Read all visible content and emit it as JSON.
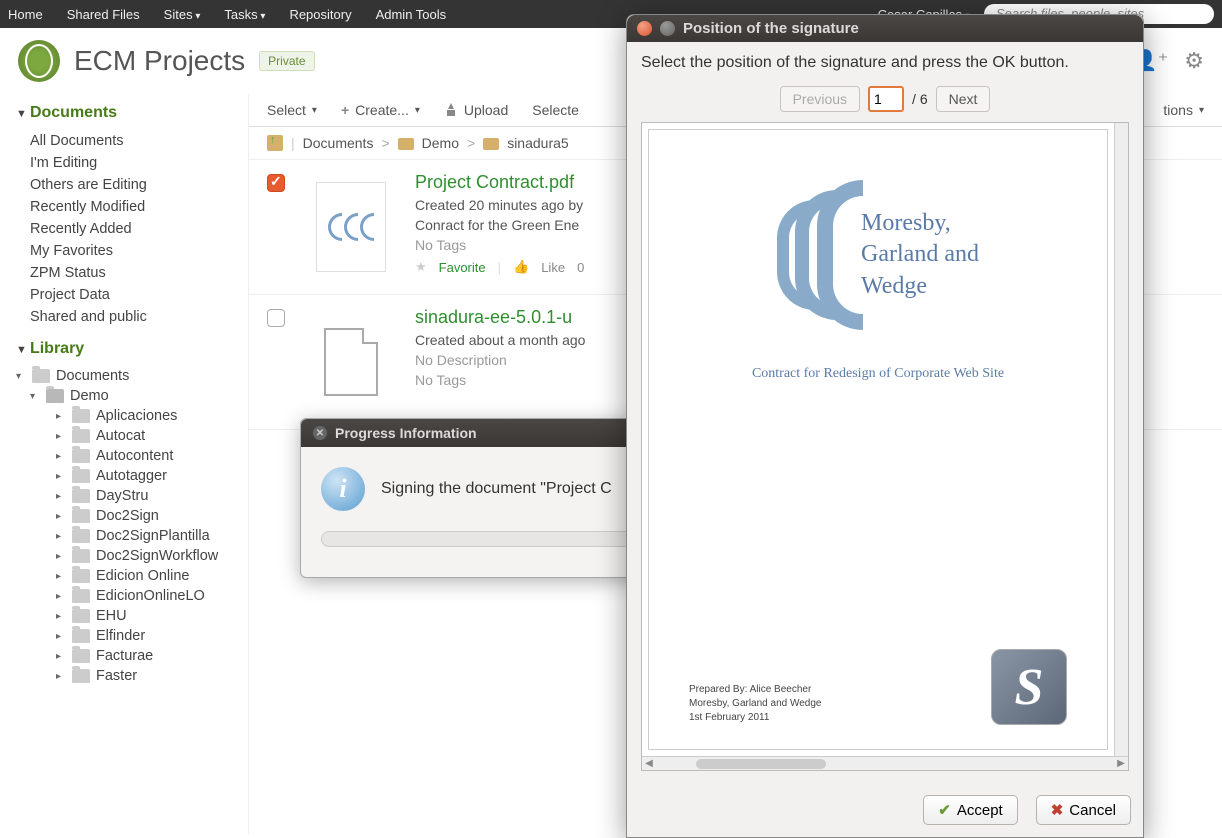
{
  "topnav": {
    "items": [
      "Home",
      "Shared Files",
      "Sites",
      "Tasks",
      "Repository",
      "Admin Tools"
    ],
    "user": "Cesar Capillas",
    "search_placeholder": "Search files, people, sites"
  },
  "header": {
    "title": "ECM Projects",
    "badge": "Private"
  },
  "sidebar": {
    "documents_title": "Documents",
    "documents": [
      "All Documents",
      "I'm Editing",
      "Others are Editing",
      "Recently Modified",
      "Recently Added",
      "My Favorites",
      "ZPM Status",
      "Project Data",
      "Shared and public"
    ],
    "library_title": "Library",
    "tree_root": "Documents",
    "tree_demo": "Demo",
    "tree_children": [
      "Aplicaciones",
      "Autocat",
      "Autocontent",
      "Autotagger",
      "DayStru",
      "Doc2Sign",
      "Doc2SignPlantilla",
      "Doc2SignWorkflow",
      "Edicion Online",
      "EdicionOnlineLO",
      "EHU",
      "Elfinder",
      "Facturae",
      "Faster"
    ]
  },
  "toolbar": {
    "select": "Select",
    "create": "Create...",
    "upload": "Upload",
    "selected": "Selecte",
    "options": "tions"
  },
  "breadcrumb": {
    "root": "Documents",
    "l1": "Demo",
    "l2": "sinadura5"
  },
  "docs": [
    {
      "title": "Project Contract.pdf",
      "created": "Created 20 minutes ago by",
      "desc": "Conract for the Green Ene",
      "tags": "No Tags",
      "favorite": "Favorite",
      "like": "Like",
      "like_count": "0",
      "checked": true,
      "thumb": "logo"
    },
    {
      "title": "sinadura-ee-5.0.1-u",
      "created": "Created about a month ago",
      "desc": "No Description",
      "tags": "No Tags",
      "checked": false,
      "thumb": "file"
    }
  ],
  "progress": {
    "title": "Progress Information",
    "message": "Signing the document \"Project C"
  },
  "signature": {
    "title": "Position of the signature",
    "instruction": "Select the position of the signature and press the OK button.",
    "prev": "Previous",
    "next": "Next",
    "page": "1",
    "total": "/ 6",
    "accept": "Accept",
    "cancel": "Cancel",
    "doc": {
      "company": "Moresby, Garland and Wedge",
      "subtitle": "Contract for Redesign of Corporate Web Site",
      "prepared_by": "Prepared By: Alice Beecher",
      "prepared_co": "Moresby, Garland and Wedge",
      "prepared_date": "1st February 2011"
    }
  }
}
